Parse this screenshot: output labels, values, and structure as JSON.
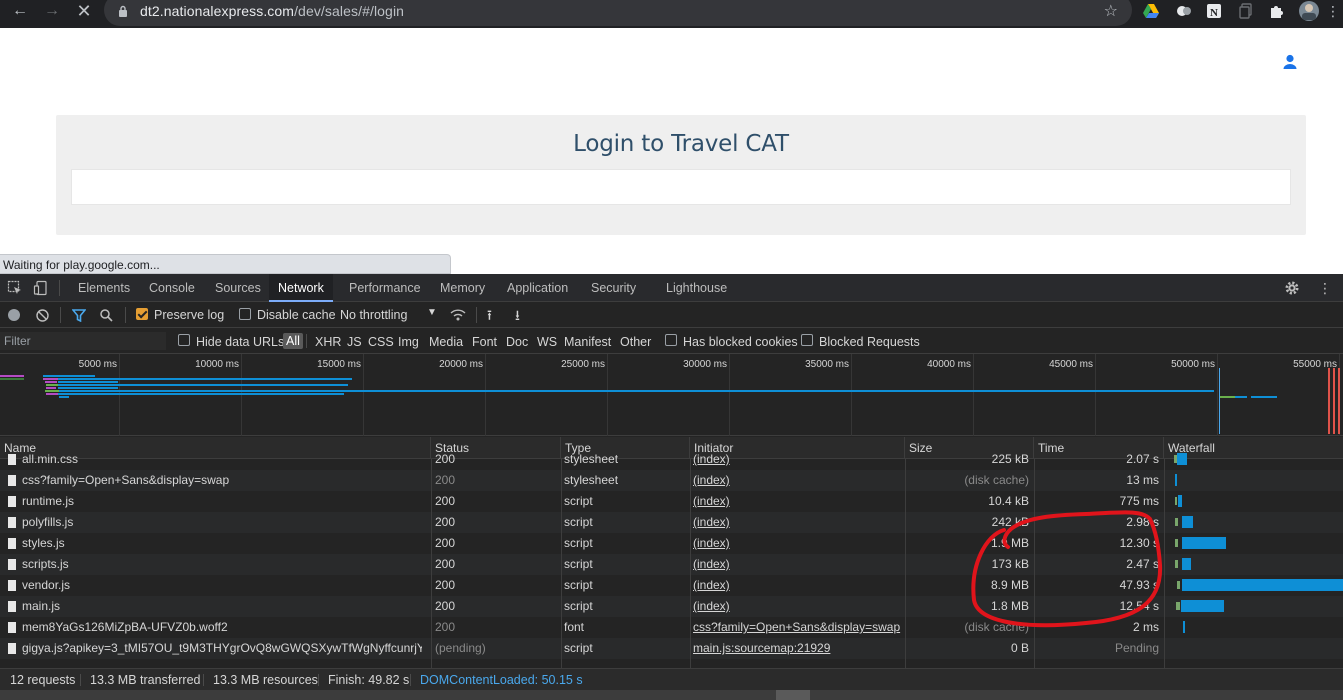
{
  "browser": {
    "url_host": "dt2.nationalexpress.com",
    "url_path": "/dev/sales/#/login",
    "status_bubble": "Waiting for play.google.com..."
  },
  "page": {
    "login_title": "Login to Travel CAT"
  },
  "devtools": {
    "tabs": [
      "Elements",
      "Console",
      "Sources",
      "Network",
      "Performance",
      "Memory",
      "Application",
      "Security",
      "Lighthouse"
    ],
    "active_tab": "Network",
    "toolbar": {
      "preserve_log": "Preserve log",
      "disable_cache": "Disable cache",
      "throttling": "No throttling"
    },
    "filter": {
      "placeholder": "Filter",
      "hide_data_urls": "Hide data URLs",
      "types": [
        "All",
        "XHR",
        "JS",
        "CSS",
        "Img",
        "Media",
        "Font",
        "Doc",
        "WS",
        "Manifest",
        "Other"
      ],
      "has_blocked_cookies": "Has blocked cookies",
      "blocked_requests": "Blocked Requests"
    },
    "overview_ticks": [
      "5000 ms",
      "10000 ms",
      "15000 ms",
      "20000 ms",
      "25000 ms",
      "30000 ms",
      "35000 ms",
      "40000 ms",
      "45000 ms",
      "50000 ms",
      "55000 ms"
    ],
    "columns": [
      "Name",
      "Status",
      "Type",
      "Initiator",
      "Size",
      "Time",
      "Waterfall"
    ],
    "rows": [
      {
        "name": "all.min.css",
        "status": "200",
        "type": "stylesheet",
        "initiator": "(index)",
        "size": "225 kB",
        "time": "2.07 s"
      },
      {
        "name": "css?family=Open+Sans&display=swap",
        "status": "200",
        "type": "stylesheet",
        "initiator": "(index)",
        "size": "(disk cache)",
        "time": "13 ms"
      },
      {
        "name": "runtime.js",
        "status": "200",
        "type": "script",
        "initiator": "(index)",
        "size": "10.4 kB",
        "time": "775 ms"
      },
      {
        "name": "polyfills.js",
        "status": "200",
        "type": "script",
        "initiator": "(index)",
        "size": "242 kB",
        "time": "2.98 s"
      },
      {
        "name": "styles.js",
        "status": "200",
        "type": "script",
        "initiator": "(index)",
        "size": "1.9 MB",
        "time": "12.30 s"
      },
      {
        "name": "scripts.js",
        "status": "200",
        "type": "script",
        "initiator": "(index)",
        "size": "173 kB",
        "time": "2.47 s"
      },
      {
        "name": "vendor.js",
        "status": "200",
        "type": "script",
        "initiator": "(index)",
        "size": "8.9 MB",
        "time": "47.93 s"
      },
      {
        "name": "main.js",
        "status": "200",
        "type": "script",
        "initiator": "(index)",
        "size": "1.8 MB",
        "time": "12.54 s"
      },
      {
        "name": "mem8YaGs126MiZpBA-UFVZ0b.woff2",
        "status": "200",
        "type": "font",
        "initiator": "css?family=Open+Sans&display=swap",
        "size": "(disk cache)",
        "time": "2 ms"
      },
      {
        "name": "gigya.js?apikey=3_tMI57OU_t9M3THYgrOvQ8wGWQSXywTfWgNyffcunrjY...",
        "status": "(pending)",
        "type": "script",
        "initiator": "main.js:sourcemap:21929",
        "size": "0 B",
        "time": "Pending"
      }
    ],
    "status_bar": {
      "requests": "12 requests",
      "transferred": "13.3 MB transferred",
      "resources": "13.3 MB resources",
      "finish": "Finish: 49.82 s",
      "dcl": "DOMContentLoaded: 50.15 s"
    }
  },
  "colors": {
    "accent_blue": "#0e8fd6",
    "annotation_red": "#e0141b",
    "preserve_log_orange": "#e59e33"
  }
}
